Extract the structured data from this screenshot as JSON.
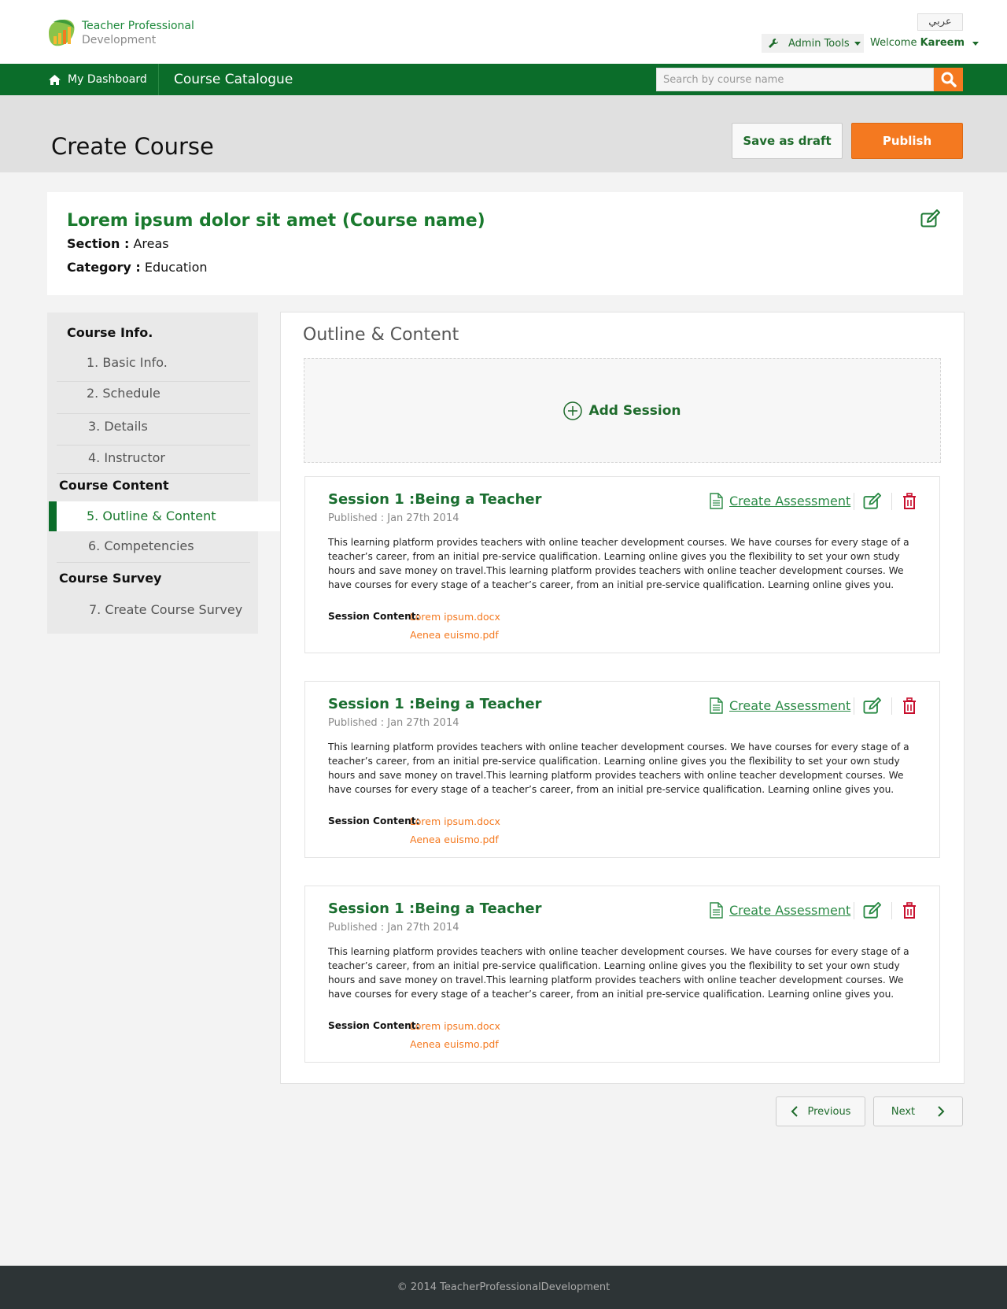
{
  "header": {
    "logo_line1": "Teacher Professional",
    "logo_line2": "Development",
    "language_button": "عربي",
    "admin_tools": "Admin Tools",
    "welcome_prefix": "Welcome",
    "user_name": "Kareem"
  },
  "nav": {
    "dashboard": "My Dashboard",
    "catalogue": "Course Catalogue",
    "search_placeholder": "Search by course name",
    "search_value": ""
  },
  "page": {
    "title": "Create Course",
    "save_draft": "Save as draft",
    "publish": "Publish"
  },
  "course": {
    "name": "Lorem ipsum dolor sit amet (Course name)",
    "section_label": "Section :",
    "section_value": "Areas",
    "category_label": "Category :",
    "category_value": "Education"
  },
  "sidebar": {
    "group_info": "Course Info.",
    "group_content": "Course Content",
    "group_survey": "Course Survey",
    "items": [
      {
        "label": "1. Basic Info."
      },
      {
        "label": "2. Schedule"
      },
      {
        "label": "3. Details"
      },
      {
        "label": "4. Instructor"
      },
      {
        "label": "5. Outline & Content",
        "active": true
      },
      {
        "label": "6. Competencies"
      },
      {
        "label": "7. Create Course Survey"
      }
    ]
  },
  "main": {
    "title": "Outline & Content",
    "add_session": "Add Session",
    "create_assessment": "Create Assessment",
    "content_label": "Session Content:",
    "sessions": [
      {
        "title": "Session 1 :Being a Teacher",
        "published": "Published : Jan 27th 2014",
        "description": "This learning platform provides teachers with online teacher development courses. We have courses for every stage of a teacher’s career, from an initial pre-service qualification. Learning online gives you the flexibility to set your own study hours and save money on travel.This learning platform provides teachers with online teacher development courses. We have courses for every stage of a teacher’s career, from an initial pre-service qualification. Learning online gives you.",
        "files": [
          "Lorem ipsum.docx",
          "Aenea euismo.pdf"
        ]
      },
      {
        "title": "Session 1 :Being a Teacher",
        "published": "Published : Jan 27th 2014",
        "description": "This learning platform provides teachers with online teacher development courses. We have courses for every stage of a teacher’s career, from an initial pre-service qualification. Learning online gives you the flexibility to set your own study hours and save money on travel.This learning platform provides teachers with online teacher development courses. We have courses for every stage of a teacher’s career, from an initial pre-service qualification. Learning online gives you.",
        "files": [
          "Lorem ipsum.docx",
          "Aenea euismo.pdf"
        ]
      },
      {
        "title": "Session 1 :Being a Teacher",
        "published": "Published : Jan 27th 2014",
        "description": "This learning platform provides teachers with online teacher development courses. We have courses for every stage of a teacher’s career, from an initial pre-service qualification. Learning online gives you the flexibility to set your own study hours and save money on travel.This learning platform provides teachers with online teacher development courses. We have courses for every stage of a teacher’s career, from an initial pre-service qualification. Learning online gives you.",
        "files": [
          "Lorem ipsum.docx",
          "Aenea euismo.pdf"
        ]
      }
    ]
  },
  "pager": {
    "previous": "Previous",
    "next": "Next"
  },
  "footer": {
    "copyright": "© 2014 TeacherProfessionalDevelopment"
  },
  "colors": {
    "brand_green": "#0b6d2a",
    "accent_orange": "#f47920",
    "delete_red": "#c8102e"
  },
  "icons": {
    "logo": "logo-icon",
    "admin": "wrench-icon",
    "home": "home-icon",
    "search": "search-icon",
    "edit": "edit-icon",
    "document": "document-icon",
    "delete": "trash-icon",
    "add": "plus-circle-icon",
    "prev": "chevron-left-icon",
    "next": "chevron-right-icon"
  }
}
